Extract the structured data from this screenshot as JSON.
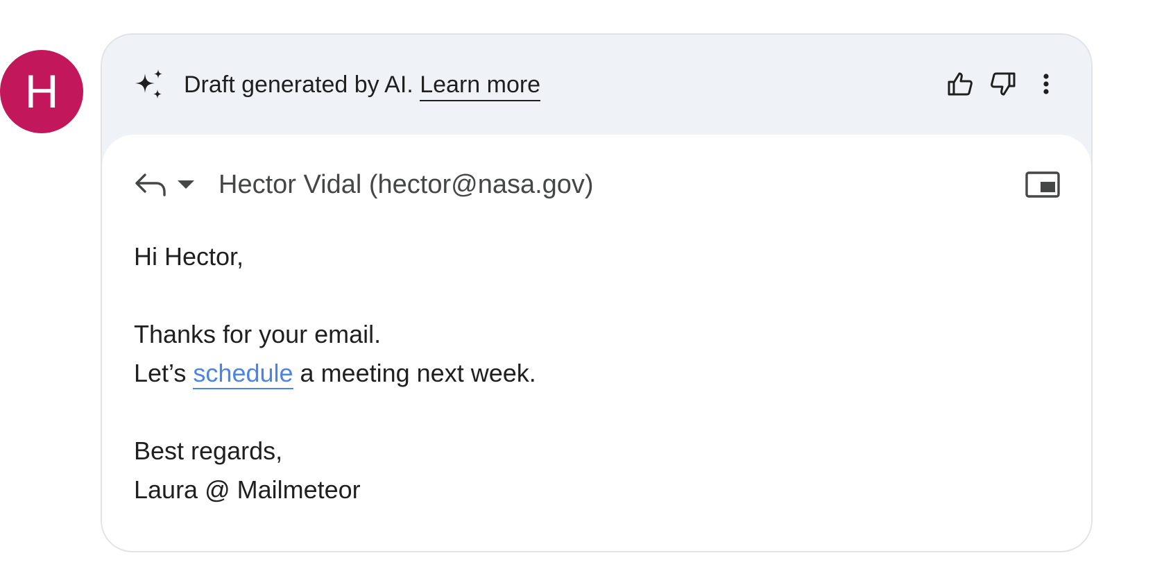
{
  "colors": {
    "avatar_bg": "#c2185b",
    "banner_bg": "#eff2f7",
    "link": "#4a84e8",
    "text": "#1f1f1f",
    "muted": "#444746"
  },
  "avatar": {
    "initial": "H"
  },
  "banner": {
    "icon": "sparkle-icon",
    "text": "Draft generated by AI.",
    "learn_more": "Learn more",
    "actions": [
      "thumbs-up-icon",
      "thumbs-down-icon",
      "more-vert-icon"
    ]
  },
  "compose": {
    "reply_icon": "reply-icon",
    "dropdown_icon": "arrow-drop-down-icon",
    "recipient": "Hector Vidal (hector@nasa.gov)",
    "popout_icon": "pop-out-icon"
  },
  "message": {
    "greeting": "Hi Hector,",
    "line1": "Thanks for your email.",
    "line2_before": "Let’s",
    "line2_link": "schedule",
    "line2_after": "a meeting next week.",
    "closing": "Best regards,",
    "signature": "Laura @ Mailmeteor"
  }
}
